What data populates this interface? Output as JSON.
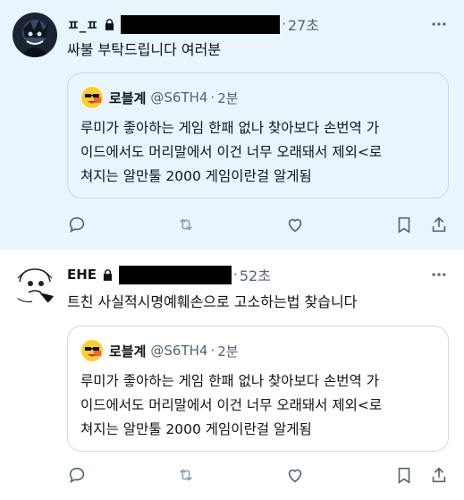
{
  "posts": [
    {
      "author": "ㅍ_ㅍ",
      "time": "27초",
      "text": "싸불 부탁드립니다 여러분",
      "avatar_icon": "dark-character-avatar",
      "quote": {
        "name": "로블계",
        "handle": "@S6TH4",
        "time": "2분",
        "line1": "루미가 좋아하는 게임 한패 없나 찾아보다 손번역 가",
        "line2": "이드에서도 머리말에서 이건 너무 오래돼서 제외<로",
        "line3": "쳐지는 알만툴 2000 게임이란걸 알게됨"
      }
    },
    {
      "author": "EHE",
      "time": "52초",
      "text": "트친 사실적시명예훼손으로 고소하는법 찾습니다",
      "avatar_icon": "sketch-character-avatar",
      "quote": {
        "name": "로블계",
        "handle": "@S6TH4",
        "time": "2분",
        "line1": "루미가 좋아하는 게임 한패 없나 찾아보다 손번역 가",
        "line2": "이드에서도 머리말에서 이건 너무 오래돼서 제외<로",
        "line3": "쳐지는 알만툴 2000 게임이란걸 알게됨"
      }
    }
  ],
  "separator": "·",
  "colors": {
    "highlight_bg": "#e8f5fd",
    "secondary_text": "#536471",
    "border": "#cfd9de"
  }
}
